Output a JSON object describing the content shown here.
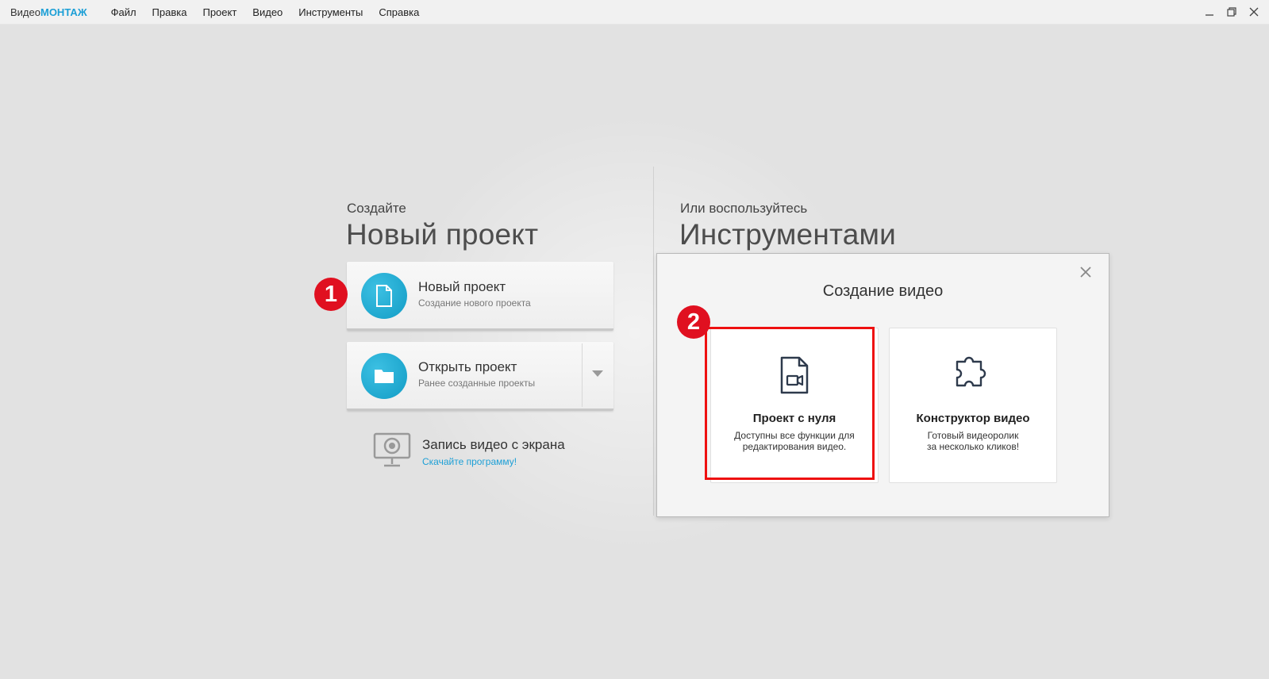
{
  "app": {
    "title_prefix": "Видео",
    "title_accent": "МОНТАЖ",
    "accent_color": "#1c9fd6"
  },
  "menu": [
    "Файл",
    "Правка",
    "Проект",
    "Видео",
    "Инструменты",
    "Справка"
  ],
  "left": {
    "pre": "Создайте",
    "title": "Новый проект",
    "new_project": {
      "title": "Новый проект",
      "subtitle": "Создание нового проекта",
      "icon": "document-icon"
    },
    "open_project": {
      "title": "Открыть проект",
      "subtitle": "Ранее созданные проекты",
      "icon": "folder-icon"
    },
    "record": {
      "title": "Запись видео с экрана",
      "link": "Скачайте программу!",
      "icon": "screen-record-icon"
    }
  },
  "right": {
    "pre": "Или воспользуйтесь",
    "title": "Инструментами"
  },
  "dialog": {
    "title": "Создание видео",
    "options": [
      {
        "title": "Проект с нуля",
        "desc_line1": "Доступны все функции для",
        "desc_line2": "редактирования видео.",
        "icon": "video-file-icon"
      },
      {
        "title": "Конструктор видео",
        "desc_line1": "Готовый видеоролик",
        "desc_line2": "за несколько кликов!",
        "icon": "puzzle-icon"
      }
    ]
  },
  "badges": [
    "1",
    "2"
  ],
  "highlight_color": "#ee1010"
}
